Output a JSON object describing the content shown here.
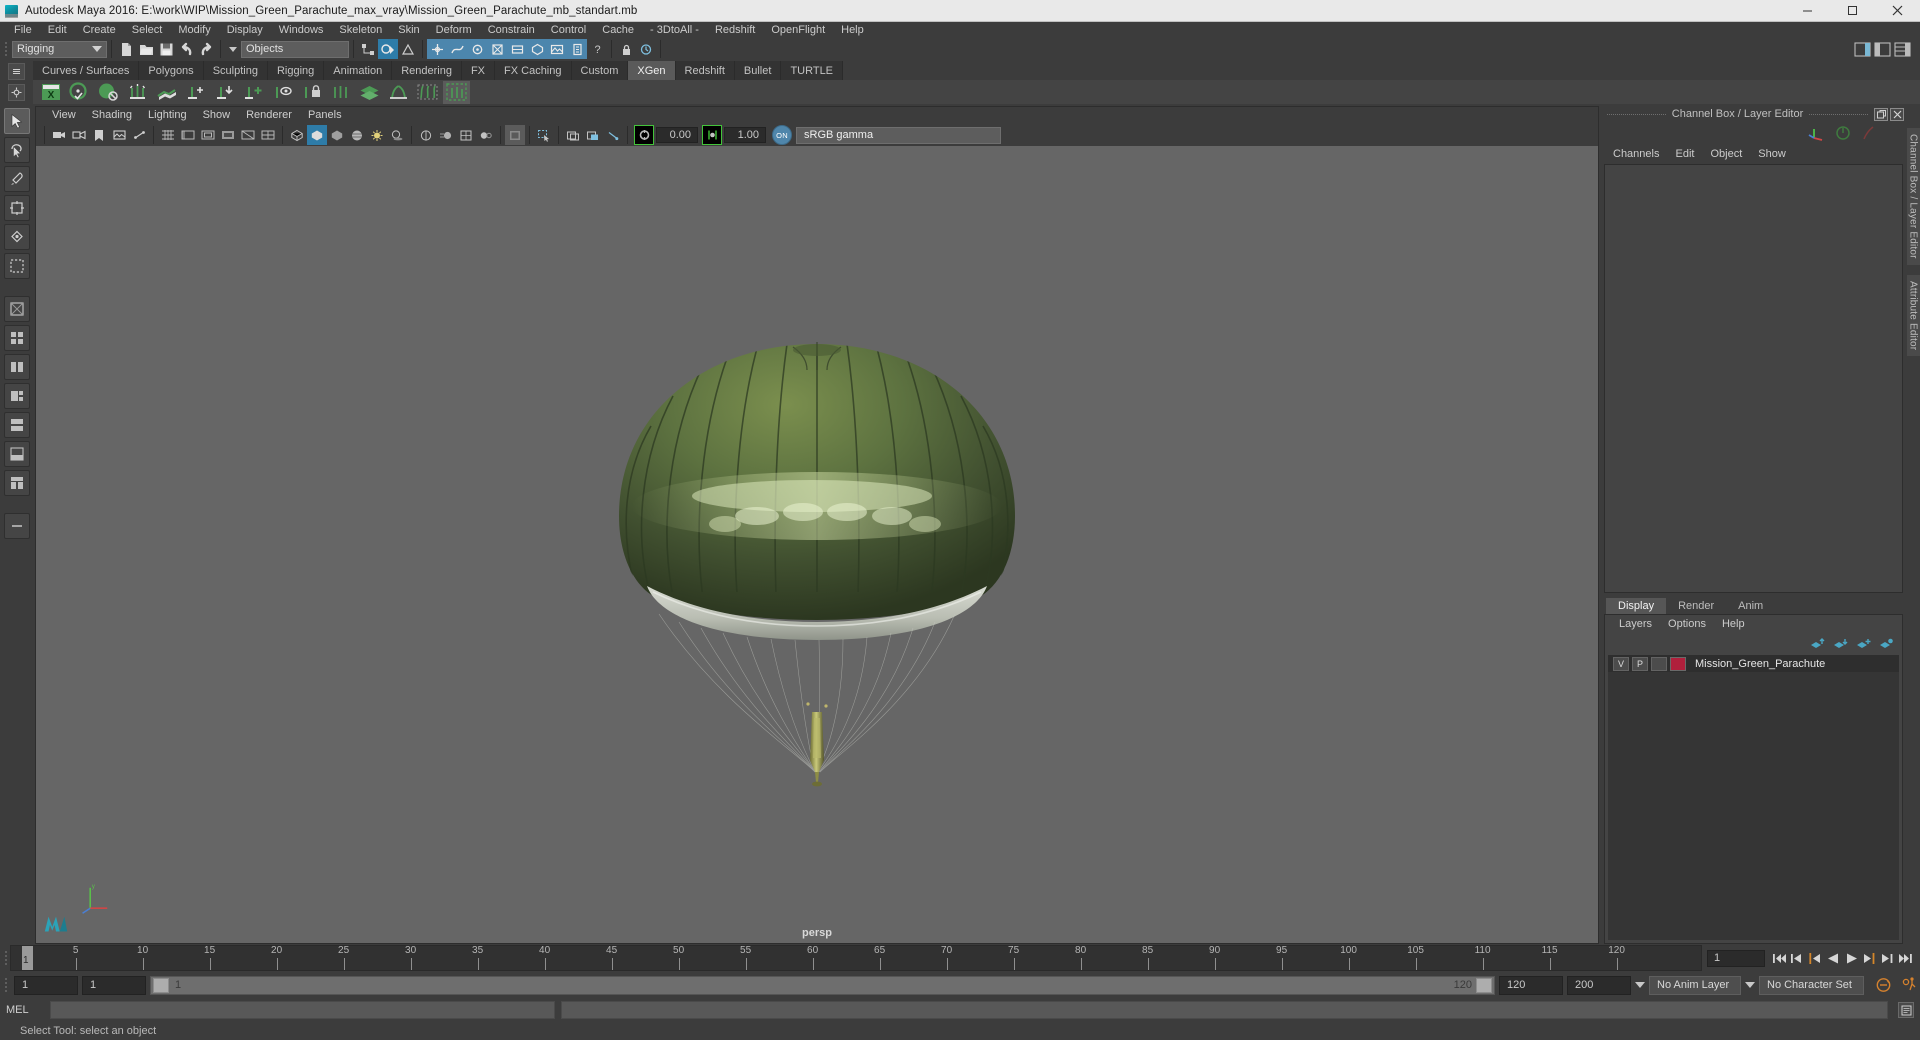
{
  "window": {
    "title": "Autodesk Maya 2016: E:\\work\\WIP\\Mission_Green_Parachute_max_vray\\Mission_Green_Parachute_mb_standart.mb",
    "minimize_label": "Minimize",
    "maximize_label": "Maximize",
    "close_label": "Close"
  },
  "menubar": {
    "items": [
      {
        "label": "File"
      },
      {
        "label": "Edit"
      },
      {
        "label": "Create"
      },
      {
        "label": "Select"
      },
      {
        "label": "Modify"
      },
      {
        "label": "Display"
      },
      {
        "label": "Windows"
      },
      {
        "label": "Skeleton"
      },
      {
        "label": "Skin"
      },
      {
        "label": "Deform"
      },
      {
        "label": "Constrain"
      },
      {
        "label": "Control"
      },
      {
        "label": "Cache"
      },
      {
        "label": "- 3DtoAll -"
      },
      {
        "label": "Redshift"
      },
      {
        "label": "OpenFlight"
      },
      {
        "label": "Help"
      }
    ]
  },
  "statusbar": {
    "menuset": "Rigging",
    "selection_mask": "Objects",
    "new_scene_icon": "new-file-icon",
    "open_scene_icon": "open-folder-icon",
    "save_scene_icon": "save-disk-icon",
    "undo_icon": "undo-arrow-icon",
    "redo_icon": "redo-arrow-icon",
    "lock_icon": "lock-icon"
  },
  "shelf": {
    "tabs": [
      {
        "label": "Curves / Surfaces",
        "active": false
      },
      {
        "label": "Polygons",
        "active": false
      },
      {
        "label": "Sculpting",
        "active": false
      },
      {
        "label": "Rigging",
        "active": false
      },
      {
        "label": "Animation",
        "active": false
      },
      {
        "label": "Rendering",
        "active": false
      },
      {
        "label": "FX",
        "active": false
      },
      {
        "label": "FX Caching",
        "active": false
      },
      {
        "label": "Custom",
        "active": false
      },
      {
        "label": "XGen",
        "active": true
      },
      {
        "label": "Redshift",
        "active": false
      },
      {
        "label": "Bullet",
        "active": false
      },
      {
        "label": "TURTLE",
        "active": false
      }
    ],
    "buttons": [
      {
        "name": "xgen-editor-icon"
      },
      {
        "name": "xgen-sphere-check-icon"
      },
      {
        "name": "xgen-sphere-deny-icon"
      },
      {
        "name": "xgen-guides-icon"
      },
      {
        "name": "xgen-flat-patch-icon"
      },
      {
        "name": "xgen-add-guide-icon"
      },
      {
        "name": "xgen-down-guide-icon"
      },
      {
        "name": "xgen-plus-icon"
      },
      {
        "name": "xgen-eye-icon"
      },
      {
        "name": "xgen-lock-icon"
      },
      {
        "name": "xgen-split-icon"
      },
      {
        "name": "xgen-layers-icon"
      },
      {
        "name": "xgen-clump-icon"
      },
      {
        "name": "xgen-noise-icon"
      },
      {
        "name": "xgen-region-icon"
      }
    ]
  },
  "toolbox": {
    "tools": [
      {
        "name": "select-tool",
        "selected": true
      },
      {
        "name": "lasso-select-tool",
        "selected": false
      },
      {
        "name": "paint-select-tool",
        "selected": false
      },
      {
        "name": "move-tool",
        "selected": false
      },
      {
        "name": "rotate-tool",
        "selected": false
      },
      {
        "name": "scale-tool",
        "selected": false
      },
      {
        "name": "last-tool",
        "selected": false
      }
    ],
    "layouts": [
      {
        "name": "single-perspective-layout"
      },
      {
        "name": "four-view-layout"
      },
      {
        "name": "side-by-side-layout"
      },
      {
        "name": "persp-outliner-layout"
      },
      {
        "name": "hypergraph-layout"
      },
      {
        "name": "persp-graph-layout"
      },
      {
        "name": "quad-variant-layout"
      },
      {
        "name": "more-layouts"
      }
    ]
  },
  "viewport": {
    "menus": [
      {
        "label": "View"
      },
      {
        "label": "Shading"
      },
      {
        "label": "Lighting"
      },
      {
        "label": "Show"
      },
      {
        "label": "Renderer"
      },
      {
        "label": "Panels"
      }
    ],
    "exposure_value": "0.00",
    "gamma_value": "1.00",
    "color_management_toggle": "ON",
    "view_transform": "sRGB gamma",
    "camera_label": "persp"
  },
  "channel_box": {
    "panel_title": "Channel Box / Layer Editor",
    "tabs": [
      {
        "label": "Channels"
      },
      {
        "label": "Edit"
      },
      {
        "label": "Object"
      },
      {
        "label": "Show"
      }
    ]
  },
  "layer_editor": {
    "tabs": [
      {
        "label": "Display",
        "active": true
      },
      {
        "label": "Render",
        "active": false
      },
      {
        "label": "Anim",
        "active": false
      }
    ],
    "menus": [
      {
        "label": "Layers"
      },
      {
        "label": "Options"
      },
      {
        "label": "Help"
      }
    ],
    "toolbar_icons": [
      {
        "name": "move-layer-up-icon"
      },
      {
        "name": "move-layer-down-icon"
      },
      {
        "name": "new-layer-icon"
      },
      {
        "name": "new-layer-from-selected-icon"
      }
    ],
    "layers": [
      {
        "visibility": "V",
        "playback": "P",
        "color": "#b0203c",
        "name": "Mission_Green_Parachute"
      }
    ]
  },
  "right_vtabs": [
    {
      "label": "Channel Box / Layer Editor"
    },
    {
      "label": "Attribute Editor"
    }
  ],
  "timeline": {
    "start": 1,
    "end": 120,
    "current_frame": "1",
    "tick_labels": [
      5,
      10,
      15,
      20,
      25,
      30,
      35,
      40,
      45,
      50,
      55,
      60,
      65,
      70,
      75,
      80,
      85,
      90,
      95,
      100,
      105,
      110,
      115,
      120
    ],
    "playhead_label": "1",
    "playback_buttons": [
      {
        "name": "go-to-start-button"
      },
      {
        "name": "step-back-keyframe-button"
      },
      {
        "name": "step-back-frame-button"
      },
      {
        "name": "play-backwards-button"
      },
      {
        "name": "play-forwards-button"
      },
      {
        "name": "step-forward-frame-button"
      },
      {
        "name": "step-forward-keyframe-button"
      },
      {
        "name": "go-to-end-button"
      }
    ]
  },
  "range_slider": {
    "anim_start": "1",
    "range_start": "1",
    "range_bar_left_label": "1",
    "range_bar_right_label": "120",
    "range_end": "120",
    "anim_end": "200",
    "anim_layer": "No Anim Layer",
    "character_set": "No Character Set"
  },
  "command_line": {
    "label": "MEL",
    "input_value": "",
    "output_value": ""
  },
  "help_line": {
    "text": "Select Tool: select an object"
  },
  "colors": {
    "accent_blue": "#4c86ad",
    "shelf_green": "#3f8a4a",
    "layer_red": "#b0203c",
    "viewport_bg": "#666666",
    "panel_bg": "#3c3c3c"
  }
}
